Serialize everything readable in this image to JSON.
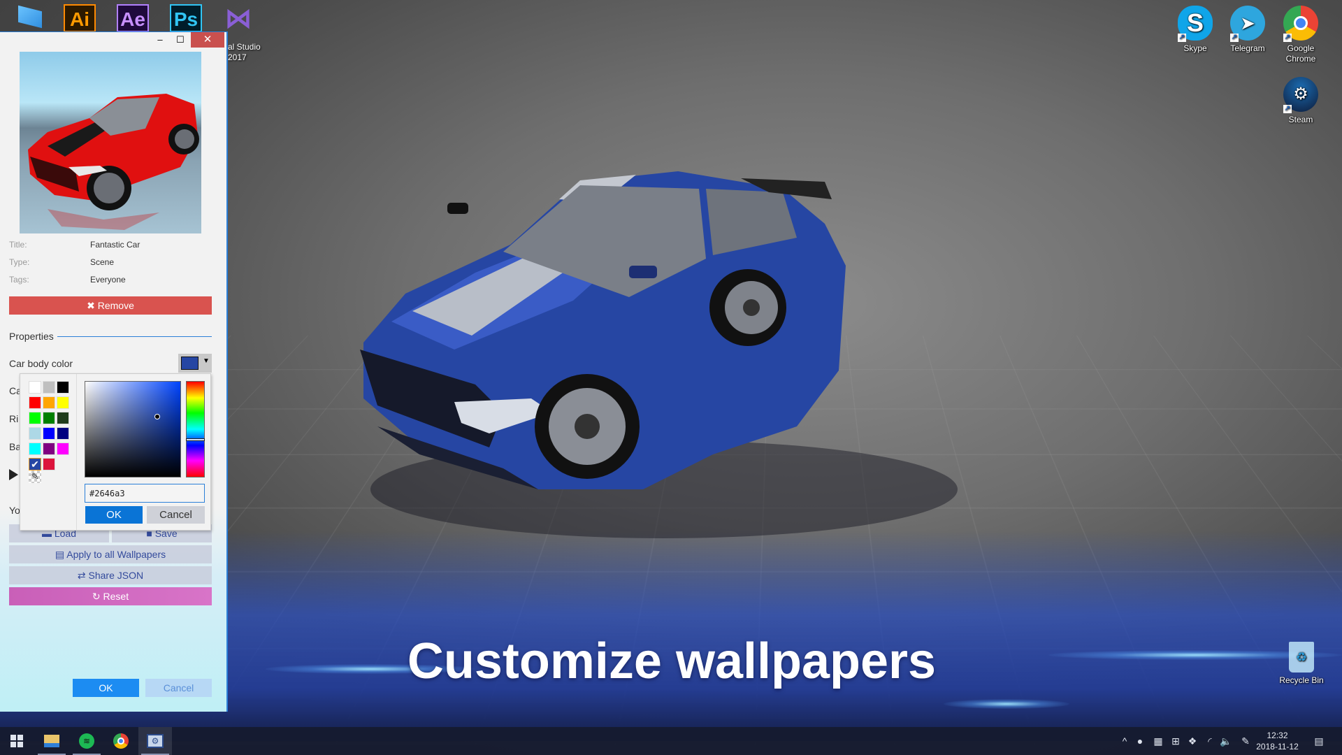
{
  "desktop": {
    "headline": "Customize wallpapers",
    "top_apps": [
      {
        "name": "Ai",
        "label": ""
      },
      {
        "name": "Ae",
        "label": ""
      },
      {
        "name": "Ps",
        "label": ""
      }
    ],
    "visual_studio_label_line1": "al Studio",
    "visual_studio_label_line2": "2017",
    "icons": [
      {
        "label": "Skype"
      },
      {
        "label": "Telegram"
      },
      {
        "label": "Google Chrome"
      },
      {
        "label": "Steam"
      },
      {
        "label": "Recycle Bin"
      }
    ]
  },
  "window": {
    "controls": {
      "minimize": "–",
      "maximize": "☐",
      "close": "✕"
    },
    "meta": [
      {
        "key": "Title:",
        "value": "Fantastic Car"
      },
      {
        "key": "Type:",
        "value": "Scene"
      },
      {
        "key": "Tags:",
        "value": "Everyone"
      }
    ],
    "remove_label": "✖ Remove",
    "properties_title": "Properties",
    "properties": [
      {
        "label": "Car body color",
        "value": "#2646a3"
      },
      {
        "label": "Ca"
      },
      {
        "label": "Ri"
      },
      {
        "label": "Ba"
      },
      {
        "label": "Yo"
      }
    ],
    "buttons": {
      "load": "Load",
      "save": "Save",
      "apply_all": "Apply to all Wallpapers",
      "share_json": "Share JSON",
      "reset": "Reset",
      "ok": "OK",
      "cancel": "Cancel"
    }
  },
  "color_picker": {
    "hex_value": "#2646a3",
    "ok_label": "OK",
    "cancel_label": "Cancel",
    "selected_color": "#2646a3",
    "palette": [
      "#ffffff",
      "#bfbfbf",
      "#000000",
      "#ff0000",
      "#ffa500",
      "#ffff00",
      "#00ff00",
      "#008000",
      "#203c1c",
      "#add8e6",
      "#0000ff",
      "#000080",
      "#00ffff",
      "#800080",
      "#ff00ff",
      "#2646a3",
      "#dc143c"
    ]
  },
  "taskbar": {
    "time": "12:32",
    "date": "2018-11-12",
    "apps": [
      "start",
      "file-explorer",
      "spotify",
      "chrome",
      "wallpaper-engine"
    ]
  }
}
